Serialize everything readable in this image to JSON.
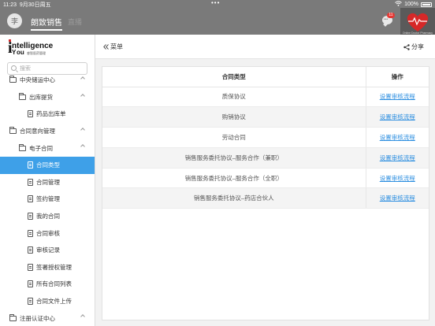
{
  "status": {
    "time": "11:23",
    "date": "9月30日周五",
    "battery": "100%"
  },
  "header": {
    "avatar_text": "李",
    "tabs": [
      {
        "label": "朗致销售",
        "active": true
      },
      {
        "label": "直播",
        "active": false
      }
    ],
    "notification_count": "11",
    "brand_caption": "Online Doctor Pharmacy"
  },
  "sidebar": {
    "logo": {
      "line1": "ntelligence",
      "line2": "ou",
      "sub": "睿智医药管理"
    },
    "search_placeholder": "搜索",
    "items": [
      {
        "label": "中央储运中心",
        "indent": 1,
        "icon": "folder-icon",
        "caret": true
      },
      {
        "label": "出库提货",
        "indent": 2,
        "icon": "folder-icon",
        "caret": true
      },
      {
        "label": "药品出库单",
        "indent": 3,
        "icon": "document-icon",
        "caret": false
      },
      {
        "label": "合同意向管理",
        "indent": 1,
        "icon": "folder-icon",
        "caret": true
      },
      {
        "label": "电子合同",
        "indent": 2,
        "icon": "folder-icon",
        "caret": true
      },
      {
        "label": "合同类型",
        "indent": 3,
        "icon": "document-icon",
        "caret": false,
        "selected": true
      },
      {
        "label": "合同管理",
        "indent": 3,
        "icon": "document-icon",
        "caret": false
      },
      {
        "label": "签约管理",
        "indent": 3,
        "icon": "document-icon",
        "caret": false
      },
      {
        "label": "我的合同",
        "indent": 3,
        "icon": "document-icon",
        "caret": false
      },
      {
        "label": "合同审核",
        "indent": 3,
        "icon": "document-icon",
        "caret": false
      },
      {
        "label": "审核记录",
        "indent": 3,
        "icon": "document-icon",
        "caret": false
      },
      {
        "label": "签署授权管理",
        "indent": 3,
        "icon": "document-icon",
        "caret": false
      },
      {
        "label": "所有合同列表",
        "indent": 3,
        "icon": "document-icon",
        "caret": false
      },
      {
        "label": "合同文件上传",
        "indent": 3,
        "icon": "document-icon",
        "caret": false
      },
      {
        "label": "注册认证中心",
        "indent": 1,
        "icon": "folder-icon",
        "caret": true
      }
    ]
  },
  "content": {
    "menu_label": "菜单",
    "share_label": "分享",
    "table": {
      "headers": [
        "合同类型",
        "操作"
      ],
      "rows": [
        {
          "type": "质保协议",
          "action": "设置审核流程"
        },
        {
          "type": "购销协议",
          "action": "设置审核流程"
        },
        {
          "type": "劳动合同",
          "action": "设置审核流程"
        },
        {
          "type": "销售服务委托协议–服务合作（兼职）",
          "action": "设置审核流程"
        },
        {
          "type": "销售服务委托协议–服务合作（全职）",
          "action": "设置审核流程"
        },
        {
          "type": "销售服务委托协议–药店合伙人",
          "action": "设置审核流程"
        }
      ]
    }
  },
  "colors": {
    "header_bg": "#7a7a7a",
    "selected_bg": "#3ea0e8",
    "link": "#2e8fe0",
    "badge": "#e53935"
  }
}
